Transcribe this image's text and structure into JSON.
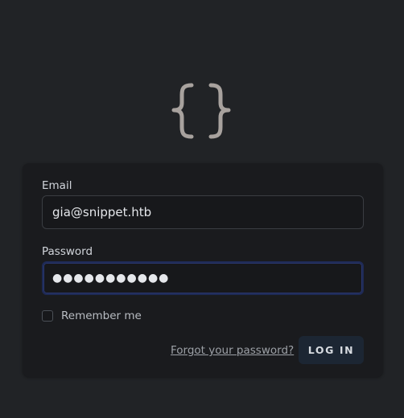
{
  "brand": {
    "logo_icon": "curly-braces-icon",
    "logo_color": "#a8a29e"
  },
  "form": {
    "email_label": "Email",
    "email_value": "gia@snippet.htb",
    "password_label": "Password",
    "password_masked": "●●●●●●●●●●●",
    "remember_label": "Remember me",
    "remember_checked": false,
    "forgot_link": "Forgot your password?",
    "login_button": "LOG IN"
  },
  "colors": {
    "background": "#212326",
    "card": "#1a1b1e",
    "focus_ring": "#1e2a55",
    "button": "#1c2633"
  }
}
